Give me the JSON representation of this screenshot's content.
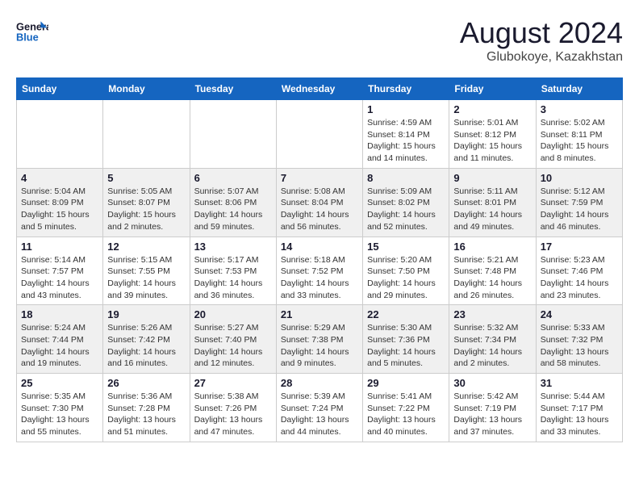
{
  "logo": {
    "line1": "General",
    "line2": "Blue"
  },
  "title": {
    "month_year": "August 2024",
    "location": "Glubokoye, Kazakhstan"
  },
  "weekdays": [
    "Sunday",
    "Monday",
    "Tuesday",
    "Wednesday",
    "Thursday",
    "Friday",
    "Saturday"
  ],
  "weeks": [
    [
      {
        "day": "",
        "info": ""
      },
      {
        "day": "",
        "info": ""
      },
      {
        "day": "",
        "info": ""
      },
      {
        "day": "",
        "info": ""
      },
      {
        "day": "1",
        "info": "Sunrise: 4:59 AM\nSunset: 8:14 PM\nDaylight: 15 hours\nand 14 minutes."
      },
      {
        "day": "2",
        "info": "Sunrise: 5:01 AM\nSunset: 8:12 PM\nDaylight: 15 hours\nand 11 minutes."
      },
      {
        "day": "3",
        "info": "Sunrise: 5:02 AM\nSunset: 8:11 PM\nDaylight: 15 hours\nand 8 minutes."
      }
    ],
    [
      {
        "day": "4",
        "info": "Sunrise: 5:04 AM\nSunset: 8:09 PM\nDaylight: 15 hours\nand 5 minutes."
      },
      {
        "day": "5",
        "info": "Sunrise: 5:05 AM\nSunset: 8:07 PM\nDaylight: 15 hours\nand 2 minutes."
      },
      {
        "day": "6",
        "info": "Sunrise: 5:07 AM\nSunset: 8:06 PM\nDaylight: 14 hours\nand 59 minutes."
      },
      {
        "day": "7",
        "info": "Sunrise: 5:08 AM\nSunset: 8:04 PM\nDaylight: 14 hours\nand 56 minutes."
      },
      {
        "day": "8",
        "info": "Sunrise: 5:09 AM\nSunset: 8:02 PM\nDaylight: 14 hours\nand 52 minutes."
      },
      {
        "day": "9",
        "info": "Sunrise: 5:11 AM\nSunset: 8:01 PM\nDaylight: 14 hours\nand 49 minutes."
      },
      {
        "day": "10",
        "info": "Sunrise: 5:12 AM\nSunset: 7:59 PM\nDaylight: 14 hours\nand 46 minutes."
      }
    ],
    [
      {
        "day": "11",
        "info": "Sunrise: 5:14 AM\nSunset: 7:57 PM\nDaylight: 14 hours\nand 43 minutes."
      },
      {
        "day": "12",
        "info": "Sunrise: 5:15 AM\nSunset: 7:55 PM\nDaylight: 14 hours\nand 39 minutes."
      },
      {
        "day": "13",
        "info": "Sunrise: 5:17 AM\nSunset: 7:53 PM\nDaylight: 14 hours\nand 36 minutes."
      },
      {
        "day": "14",
        "info": "Sunrise: 5:18 AM\nSunset: 7:52 PM\nDaylight: 14 hours\nand 33 minutes."
      },
      {
        "day": "15",
        "info": "Sunrise: 5:20 AM\nSunset: 7:50 PM\nDaylight: 14 hours\nand 29 minutes."
      },
      {
        "day": "16",
        "info": "Sunrise: 5:21 AM\nSunset: 7:48 PM\nDaylight: 14 hours\nand 26 minutes."
      },
      {
        "day": "17",
        "info": "Sunrise: 5:23 AM\nSunset: 7:46 PM\nDaylight: 14 hours\nand 23 minutes."
      }
    ],
    [
      {
        "day": "18",
        "info": "Sunrise: 5:24 AM\nSunset: 7:44 PM\nDaylight: 14 hours\nand 19 minutes."
      },
      {
        "day": "19",
        "info": "Sunrise: 5:26 AM\nSunset: 7:42 PM\nDaylight: 14 hours\nand 16 minutes."
      },
      {
        "day": "20",
        "info": "Sunrise: 5:27 AM\nSunset: 7:40 PM\nDaylight: 14 hours\nand 12 minutes."
      },
      {
        "day": "21",
        "info": "Sunrise: 5:29 AM\nSunset: 7:38 PM\nDaylight: 14 hours\nand 9 minutes."
      },
      {
        "day": "22",
        "info": "Sunrise: 5:30 AM\nSunset: 7:36 PM\nDaylight: 14 hours\nand 5 minutes."
      },
      {
        "day": "23",
        "info": "Sunrise: 5:32 AM\nSunset: 7:34 PM\nDaylight: 14 hours\nand 2 minutes."
      },
      {
        "day": "24",
        "info": "Sunrise: 5:33 AM\nSunset: 7:32 PM\nDaylight: 13 hours\nand 58 minutes."
      }
    ],
    [
      {
        "day": "25",
        "info": "Sunrise: 5:35 AM\nSunset: 7:30 PM\nDaylight: 13 hours\nand 55 minutes."
      },
      {
        "day": "26",
        "info": "Sunrise: 5:36 AM\nSunset: 7:28 PM\nDaylight: 13 hours\nand 51 minutes."
      },
      {
        "day": "27",
        "info": "Sunrise: 5:38 AM\nSunset: 7:26 PM\nDaylight: 13 hours\nand 47 minutes."
      },
      {
        "day": "28",
        "info": "Sunrise: 5:39 AM\nSunset: 7:24 PM\nDaylight: 13 hours\nand 44 minutes."
      },
      {
        "day": "29",
        "info": "Sunrise: 5:41 AM\nSunset: 7:22 PM\nDaylight: 13 hours\nand 40 minutes."
      },
      {
        "day": "30",
        "info": "Sunrise: 5:42 AM\nSunset: 7:19 PM\nDaylight: 13 hours\nand 37 minutes."
      },
      {
        "day": "31",
        "info": "Sunrise: 5:44 AM\nSunset: 7:17 PM\nDaylight: 13 hours\nand 33 minutes."
      }
    ]
  ]
}
